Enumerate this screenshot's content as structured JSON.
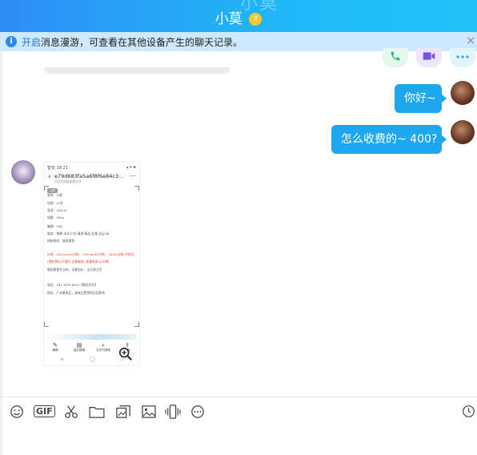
{
  "window": {
    "title": "小莫",
    "ghost_text": "小莫"
  },
  "notice": {
    "link_text": "开启",
    "text": "消息漫游，可查看在其他设备产生的聊天记录。",
    "close_icon": "×"
  },
  "call_actions": {
    "phone_icon": "phone-icon",
    "video_icon": "video-icon",
    "more_icon": "more-icon"
  },
  "messages": [
    {
      "from": "me",
      "text": "你好~"
    },
    {
      "from": "me",
      "text": "怎么收费的~ 400?"
    }
  ],
  "screenshot_card": {
    "status_left": "智安 18:21",
    "status_right": "▴ ▾ ▰",
    "file_name": "e79d683fa5a6f8f6e84c3…",
    "file_sub": "QQ浏览器查看文件",
    "tag": "注意",
    "lines": [
      "昵称：小莫",
      "年龄：23岁",
      "身高：165cm",
      "体重：49kg",
      "胸围：34B",
      "服务：按摩·沐浴·口活·漫游·毒龙·乳推·丝足·ML",
      "转账联系、服务周到",
      "价格：400/1p(40分钟)、700/2p(90分钟)、1600/过夜(不限次)",
      "(提前预约/不要开 全套服务) 需要联系QQ付款",
      "服务都是专业的，无套加价，无后顾之忧",
      "电话：181 7676 8201【微信同号】",
      "地址：广州番禺区，具体位置到附近后联系"
    ],
    "red_line_indexes": [
      7,
      8
    ],
    "tools": [
      {
        "icon": "✎",
        "label": "编辑"
      },
      {
        "icon": "▤",
        "label": "适应屏幕"
      },
      {
        "icon": "⌕",
        "label": "文件内搜索"
      },
      {
        "icon": "⇪",
        "label": "另存"
      }
    ],
    "nav": [
      "≡",
      "◯",
      "⊐"
    ]
  },
  "toolbar": {
    "items": [
      {
        "name": "emoji-icon",
        "glyph": "☺"
      },
      {
        "name": "gif-icon",
        "glyph": "GIF"
      },
      {
        "name": "scissors-icon",
        "glyph": "✂"
      },
      {
        "name": "folder-icon",
        "glyph": "🗀"
      },
      {
        "name": "screenshot-icon",
        "glyph": "⧉"
      },
      {
        "name": "image-icon",
        "glyph": "🖼"
      },
      {
        "name": "shake-icon",
        "glyph": "📳"
      },
      {
        "name": "more-icon",
        "glyph": "⋯"
      }
    ],
    "history_glyph": "🕓"
  },
  "colors": {
    "title_gradient_start": "#2e8df5",
    "title_gradient_end": "#22c2f8",
    "bubble": "#1ea7f1",
    "notice_bg": "#cde9fb"
  }
}
